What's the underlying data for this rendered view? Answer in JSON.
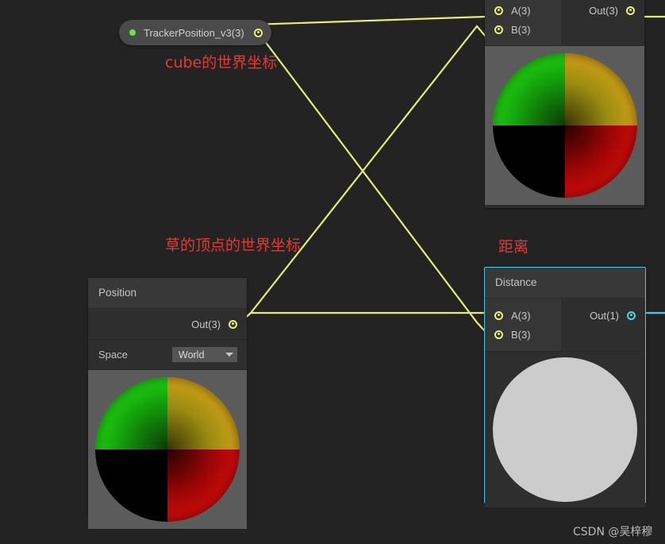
{
  "canvas": {
    "background": "#232323",
    "wire_color": "#e2ec7a",
    "wire_color_selected": "#4fc8e8",
    "selection_color": "#4fc8e8"
  },
  "property_node": {
    "label": "TrackerPosition_v3(3)",
    "dot_color": "#6fe04a",
    "out_port": "out"
  },
  "nodes": [
    {
      "id": "subtract_top",
      "title": "",
      "inputs": [
        {
          "label": "A(3)",
          "type": "vector"
        },
        {
          "label": "B(3)",
          "type": "vector"
        }
      ],
      "outputs": [
        {
          "label": "Out(3)",
          "type": "vector"
        }
      ],
      "preview": "gradient-sphere",
      "selected": false
    },
    {
      "id": "distance",
      "title": "Distance",
      "inputs": [
        {
          "label": "A(3)",
          "type": "vector"
        },
        {
          "label": "B(3)",
          "type": "vector"
        }
      ],
      "outputs": [
        {
          "label": "Out(1)",
          "type": "float"
        }
      ],
      "preview": "plain-sphere",
      "selected": true
    },
    {
      "id": "position",
      "title": "Position",
      "inputs": [],
      "outputs": [
        {
          "label": "Out(3)",
          "type": "vector"
        }
      ],
      "fields": [
        {
          "label": "Space",
          "value": "World",
          "control": "dropdown"
        }
      ],
      "preview": "gradient-sphere",
      "selected": false
    }
  ],
  "annotations": [
    {
      "id": "cube",
      "text": "cube的世界坐标",
      "color": "#e23a33"
    },
    {
      "id": "grass",
      "text": "草的顶点的世界坐标",
      "color": "#e23a33"
    },
    {
      "id": "distance",
      "text": "距离",
      "color": "#e23a33"
    }
  ],
  "watermark": {
    "text": "CSDN @吴梓穆"
  }
}
